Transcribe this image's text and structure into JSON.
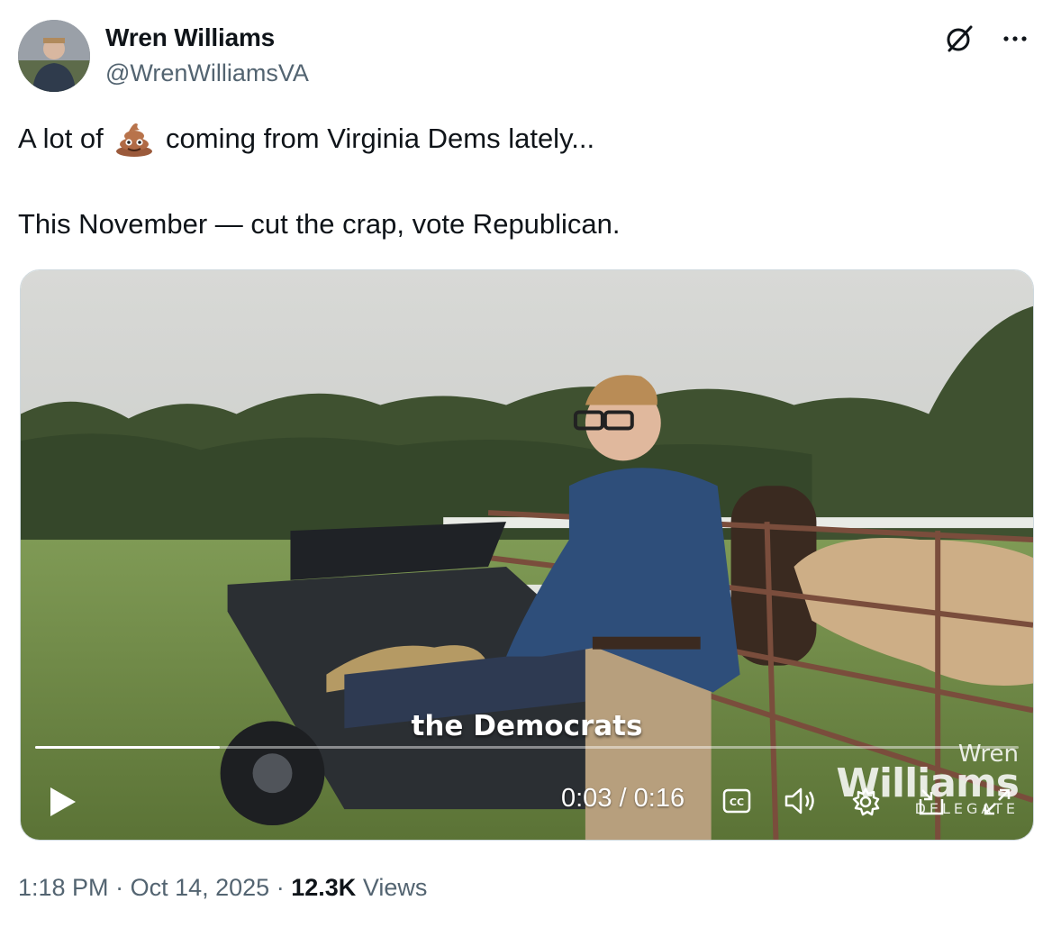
{
  "author": {
    "name": "Wren Williams",
    "handle": "@WrenWilliamsVA",
    "avatar_icon": "avatar-photo"
  },
  "header_icons": [
    "grok-icon",
    "more-icon"
  ],
  "post": {
    "line1_before": "A lot of",
    "emoji": "pile-of-poo",
    "line1_after": "coming from Virginia Dems lately...",
    "line2": "This November — cut the crap, vote Republican."
  },
  "video": {
    "caption": "the Democrats",
    "current_time": "0:03",
    "separator": "/",
    "duration": "0:16",
    "progress_fraction": 0.1875,
    "watermark_line1": "Wren",
    "watermark_line2": "Williams",
    "watermark_line3": "DELEGATE",
    "controls": [
      "play-icon",
      "captions-icon",
      "volume-icon",
      "settings-icon",
      "pip-icon",
      "fullscreen-icon"
    ]
  },
  "meta": {
    "time": "1:18 PM",
    "dot": "·",
    "date": "Oct 14, 2025",
    "views_count": "12.3K",
    "views_label": "Views"
  },
  "colors": {
    "text": "#0f1419",
    "secondary": "#536471",
    "border": "#cfd9de"
  }
}
